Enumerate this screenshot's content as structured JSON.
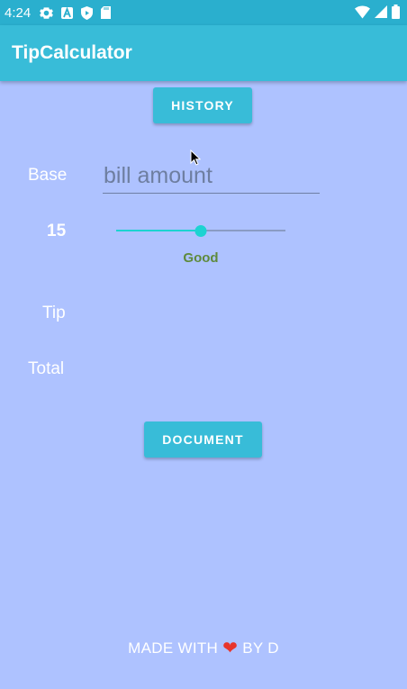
{
  "status_bar": {
    "time": "4:24",
    "icons": [
      "gear-icon",
      "a-letter-icon",
      "shield-icon",
      "sd-card-icon"
    ],
    "right_icons": [
      "wifi-icon",
      "signal-icon",
      "battery-icon"
    ]
  },
  "app": {
    "title": "TipCalculator"
  },
  "buttons": {
    "history": "HISTORY",
    "document": "DOCUMENT"
  },
  "form": {
    "base_label": "Base",
    "bill_placeholder": "bill amount",
    "bill_value": "",
    "tip_percent": "15",
    "tip_slider_fraction": 0.5,
    "rating": "Good",
    "tip_label": "Tip",
    "tip_value": "",
    "total_label": "Total",
    "total_value": ""
  },
  "footer": {
    "prefix": "MADE WITH",
    "suffix": "BY D"
  },
  "colors": {
    "background": "#AEC2FF",
    "status_bar": "#2AAFCE",
    "app_bar": "#38BCD8",
    "slider": "#1DD3D1",
    "rating": "#5E8A3C",
    "heart": "#E8342B"
  }
}
